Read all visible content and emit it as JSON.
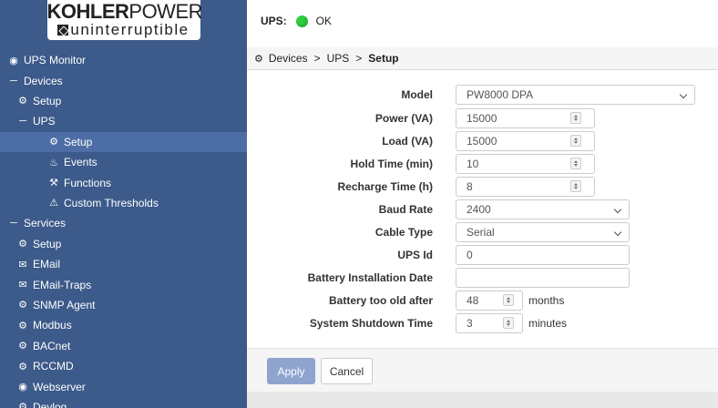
{
  "logo": {
    "brand_bold": "KOHLER",
    "brand_light": "POWER",
    "tagline": "uninterruptible"
  },
  "header": {
    "ups_label": "UPS:",
    "status": "OK",
    "status_color": "#2ecc40"
  },
  "breadcrumb": {
    "items": [
      "Devices",
      "UPS"
    ],
    "current": "Setup",
    "separator": ">"
  },
  "sidebar": {
    "background": "#3c5a8a",
    "items": [
      {
        "label": "UPS Monitor",
        "icon": "dashboard-icon"
      },
      {
        "label": "Devices",
        "icon": "minus-icon"
      },
      {
        "label": "Setup",
        "icon": "gears-icon"
      },
      {
        "label": "UPS",
        "icon": "minus-icon"
      },
      {
        "label": "Setup",
        "icon": "gear-icon",
        "active": true
      },
      {
        "label": "Events",
        "icon": "bell-icon"
      },
      {
        "label": "Functions",
        "icon": "wrench-icon"
      },
      {
        "label": "Custom Thresholds",
        "icon": "warning-icon"
      },
      {
        "label": "Services",
        "icon": "minus-icon"
      },
      {
        "label": "Setup",
        "icon": "gears-icon"
      },
      {
        "label": "EMail",
        "icon": "envelope-icon"
      },
      {
        "label": "EMail-Traps",
        "icon": "envelope-icon"
      },
      {
        "label": "SNMP Agent",
        "icon": "gear-icon"
      },
      {
        "label": "Modbus",
        "icon": "gear-icon"
      },
      {
        "label": "BACnet",
        "icon": "gear-icon"
      },
      {
        "label": "RCCMD",
        "icon": "gear-icon"
      },
      {
        "label": "Webserver",
        "icon": "globe-icon"
      },
      {
        "label": "Devlog",
        "icon": "gears-icon"
      }
    ]
  },
  "form": {
    "model": {
      "label": "Model",
      "value": "PW8000 DPA"
    },
    "power": {
      "label": "Power (VA)",
      "value": "15000"
    },
    "load": {
      "label": "Load (VA)",
      "value": "15000"
    },
    "hold_time": {
      "label": "Hold Time (min)",
      "value": "10"
    },
    "recharge_time": {
      "label": "Recharge Time (h)",
      "value": "8"
    },
    "baud_rate": {
      "label": "Baud Rate",
      "value": "2400"
    },
    "cable_type": {
      "label": "Cable Type",
      "value": "Serial"
    },
    "ups_id": {
      "label": "UPS Id",
      "value": "0"
    },
    "battery_install_date": {
      "label": "Battery Installation Date",
      "value": ""
    },
    "battery_too_old": {
      "label": "Battery too old after",
      "value": "48",
      "unit": "months"
    },
    "shutdown_time": {
      "label": "System Shutdown Time",
      "value": "3",
      "unit": "minutes"
    }
  },
  "footer": {
    "apply_label": "Apply",
    "cancel_label": "Cancel"
  }
}
